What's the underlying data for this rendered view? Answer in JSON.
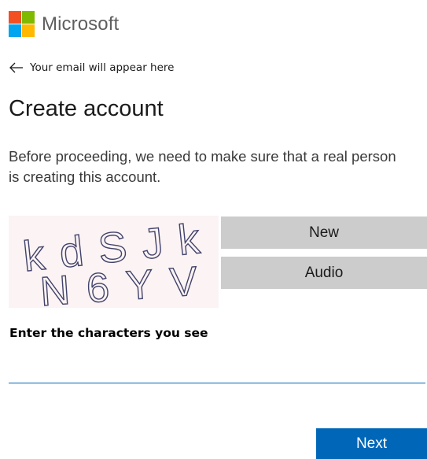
{
  "header": {
    "brand_name": "Microsoft",
    "logo_colors": [
      "#f25022",
      "#7fba00",
      "#00a4ef",
      "#ffb900"
    ]
  },
  "identity": {
    "back_icon": "back-arrow-icon",
    "email_placeholder": "Your email will appear here"
  },
  "main": {
    "title": "Create account",
    "intro": "Before proceeding, we need to make sure that a real person is creating this account."
  },
  "captcha": {
    "challenge_text": [
      "kdSJk",
      "N6YV"
    ],
    "new_label": "New",
    "audio_label": "Audio",
    "input_label": "Enter the characters you see",
    "input_value": "",
    "input_placeholder": ""
  },
  "actions": {
    "next_label": "Next"
  },
  "colors": {
    "accent": "#0067b8",
    "captcha_button_bg": "#cccccc",
    "captcha_bg": "#fbf3f4"
  }
}
